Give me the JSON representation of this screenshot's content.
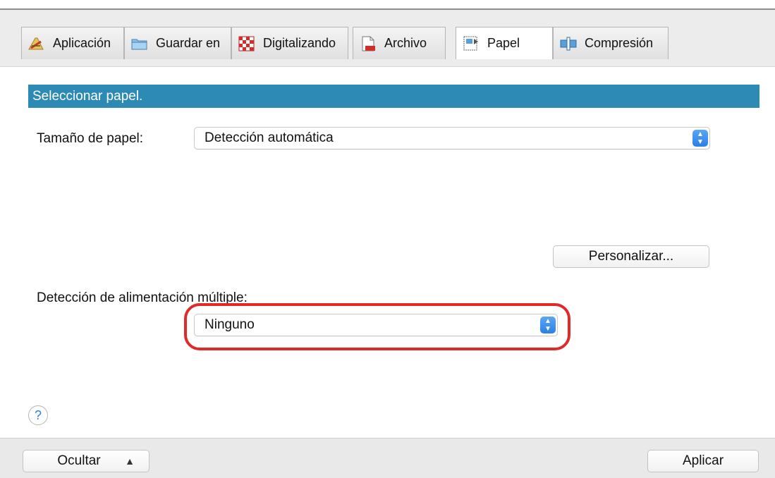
{
  "tabs": [
    {
      "label": "Aplicación",
      "icon": "application-icon",
      "active": false
    },
    {
      "label": "Guardar en",
      "icon": "folder-icon",
      "active": false
    },
    {
      "label": "Digitalizando",
      "icon": "checkerboard-icon",
      "active": false
    },
    {
      "label": "Archivo",
      "icon": "file-icon",
      "active": false
    },
    {
      "label": "Papel",
      "icon": "paper-icon",
      "active": true
    },
    {
      "label": "Compresión",
      "icon": "compression-icon",
      "active": false
    }
  ],
  "section": {
    "title": "Seleccionar papel."
  },
  "paper_size": {
    "label": "Tamaño de papel:",
    "value": "Detección automática"
  },
  "customize_button": {
    "label": "Personalizar..."
  },
  "multifeed": {
    "label": "Detección de alimentación múltiple:",
    "value": "Ninguno"
  },
  "footer": {
    "hide_label": "Ocultar",
    "apply_label": "Aplicar"
  },
  "colors": {
    "section_bar": "#2d8ab4",
    "highlight": "#e02a2a",
    "stepper": "#2d7fe6"
  }
}
